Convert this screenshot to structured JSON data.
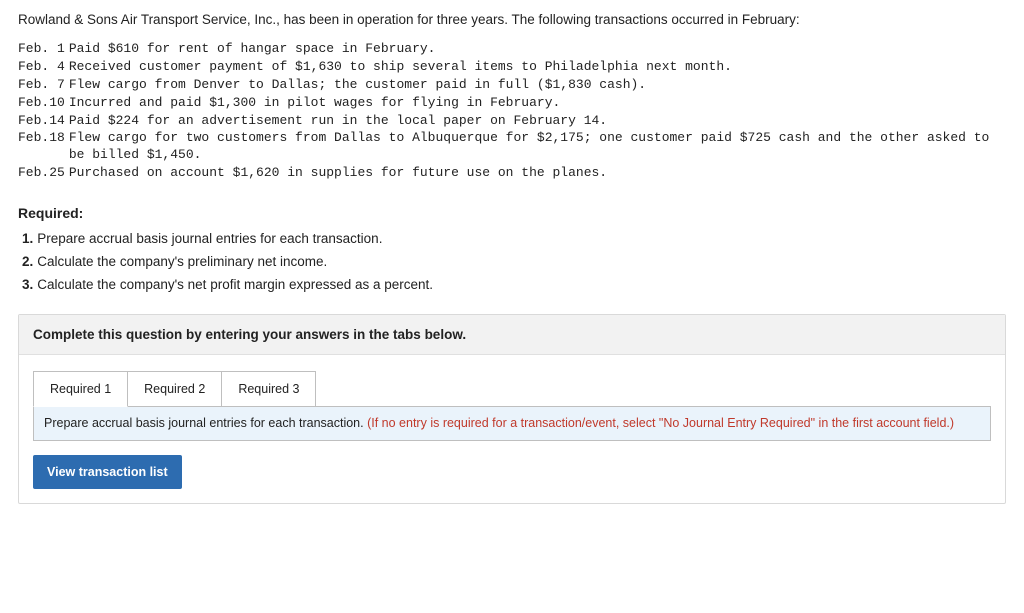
{
  "intro": "Rowland & Sons Air Transport Service, Inc., has been in operation for three years. The following transactions occurred in February:",
  "transactions": [
    {
      "date": "Feb. 1",
      "text": "Paid $610 for rent of hangar space in February."
    },
    {
      "date": "Feb. 4",
      "text": "Received customer payment of $1,630 to ship several items to Philadelphia next month."
    },
    {
      "date": "Feb. 7",
      "text": "Flew cargo from Denver to Dallas; the customer paid in full ($1,830 cash)."
    },
    {
      "date": "Feb.10",
      "text": "Incurred and paid $1,300 in pilot wages for flying in February."
    },
    {
      "date": "Feb.14",
      "text": "Paid $224 for an advertisement run in the local paper on February 14."
    },
    {
      "date": "Feb.18",
      "text": "Flew cargo for two customers from Dallas to Albuquerque for $2,175; one customer paid $725 cash and the other asked to be billed $1,450."
    },
    {
      "date": "Feb.25",
      "text": "Purchased on account $1,620 in supplies for future use on the planes."
    }
  ],
  "required_label": "Required:",
  "requirements": [
    {
      "num": "1.",
      "text": "Prepare accrual basis journal entries for each transaction."
    },
    {
      "num": "2.",
      "text": "Calculate the company's preliminary net income."
    },
    {
      "num": "3.",
      "text": "Calculate the company's net profit margin expressed as a percent."
    }
  ],
  "complete_text": "Complete this question by entering your answers in the tabs below.",
  "tabs": [
    {
      "label": "Required 1",
      "active": true
    },
    {
      "label": "Required 2",
      "active": false
    },
    {
      "label": "Required 3",
      "active": false
    }
  ],
  "tab_instruction_black": "Prepare accrual basis journal entries for each transaction. ",
  "tab_instruction_red": "(If no entry is required for a transaction/event, select \"No Journal Entry Required\" in the first account field.)",
  "view_btn": "View transaction list"
}
